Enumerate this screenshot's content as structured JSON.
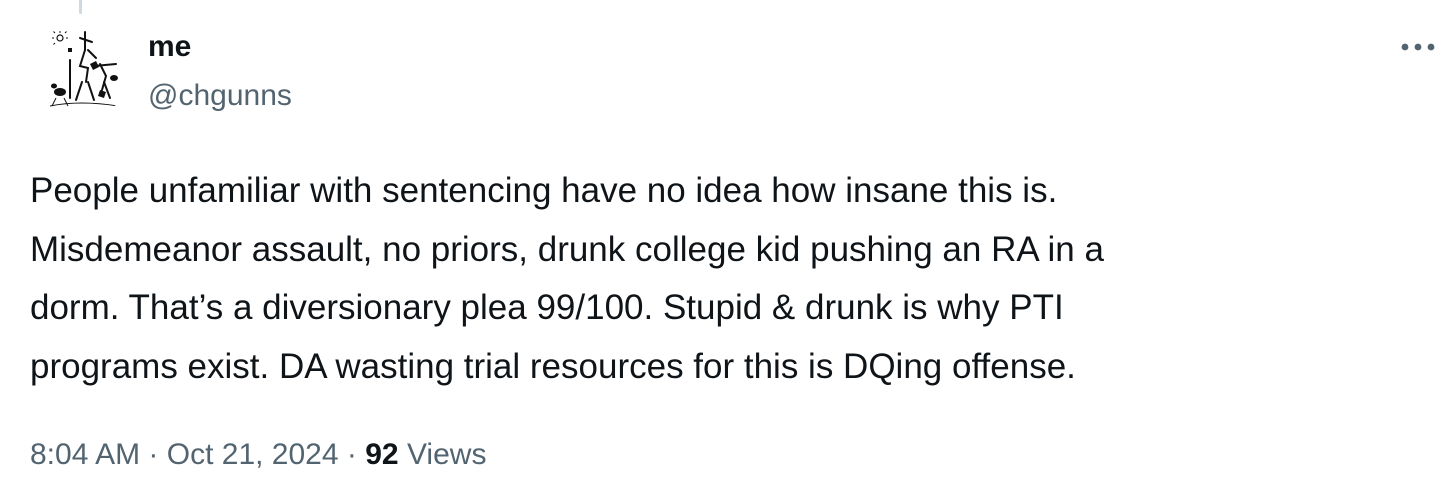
{
  "author": {
    "display_name": "me",
    "handle": "@chgunns"
  },
  "tweet": {
    "text_lines": [
      "People unfamiliar with sentencing have no idea how insane this is.",
      "Misdemeanor assault, no priors, drunk college kid pushing an RA in a",
      "dorm. That’s a diversionary plea 99/100. Stupid & drunk is why PTI",
      "programs exist. DA wasting trial resources for this is DQing offense."
    ],
    "time": "8:04 AM",
    "separator": "·",
    "date": "Oct 21, 2024",
    "views_count": "92",
    "views_label": "Views"
  },
  "icons": {
    "more": "more-horizontal-icon",
    "avatar": "don-quixote-sketch"
  },
  "colors": {
    "primary_text": "#0f1419",
    "secondary_text": "#536471",
    "thread_line": "#cfd9de"
  }
}
